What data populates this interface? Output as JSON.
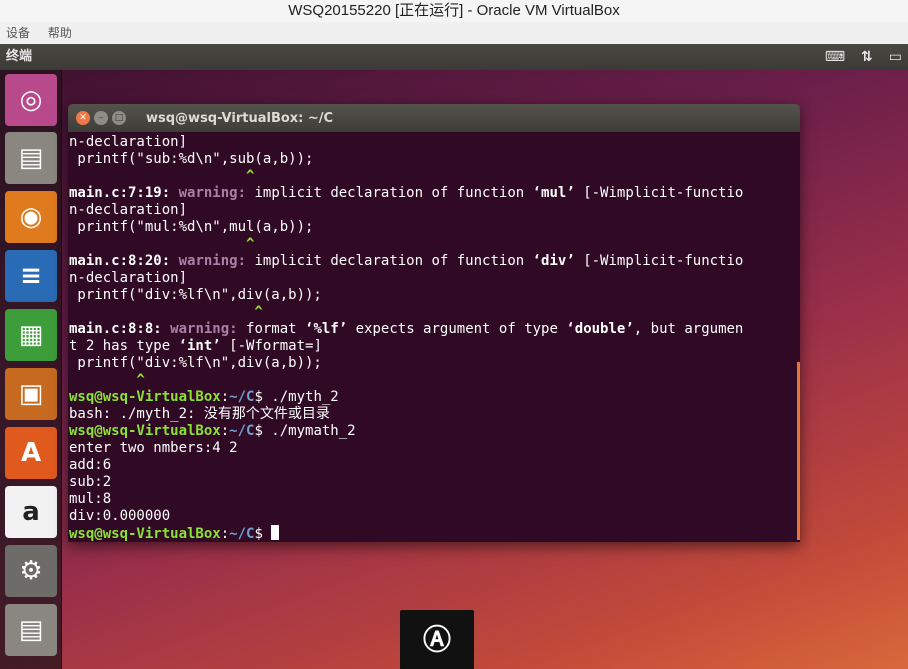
{
  "host": {
    "window_title": "WSQ20155220 [正在运行] - Oracle VM VirtualBox",
    "menu": [
      "设备",
      "帮助"
    ]
  },
  "guest": {
    "topbar_title": "终端",
    "topbar_icons": [
      "keyboard-icon",
      "network-updown-icon",
      "battery-icon"
    ],
    "launcher": [
      "ubuntu-dash",
      "files",
      "firefox",
      "libreoffice-writer",
      "libreoffice-calc",
      "libreoffice-impress",
      "ubuntu-software",
      "amazon",
      "system-settings",
      "files"
    ]
  },
  "terminal": {
    "title": "wsq@wsq-VirtualBox: ~/C",
    "prompt_user": "wsq@wsq-VirtualBox",
    "prompt_path": "~/C",
    "lines": {
      "l1": "n-declaration]",
      "l2": " printf(\"sub:%d\\n\",sub(a,b));",
      "l3": "                     ^",
      "l4_file": "main.c:7:19:",
      "l4_warn": "warning:",
      "l4_text_a": " implicit declaration of function ",
      "l4_quote": "‘mul’",
      "l4_text_b": " [-Wimplicit-functio",
      "l5": "n-declaration]",
      "l6": " printf(\"mul:%d\\n\",mul(a,b));",
      "l7": "                     ^",
      "l8_file": "main.c:8:20:",
      "l8_warn": "warning:",
      "l8_text_a": " implicit declaration of function ",
      "l8_quote": "‘div’",
      "l8_text_b": " [-Wimplicit-functio",
      "l9": "n-declaration]",
      "l10": " printf(\"div:%lf\\n\",div(a,b));",
      "l11": "                      ^",
      "l12_file": "main.c:8:8:",
      "l12_warn": "warning:",
      "l12_text_a": " format ",
      "l12_q1": "‘%lf’",
      "l12_text_b": " expects argument of type ",
      "l12_q2": "‘double’",
      "l12_text_c": ", but argumen",
      "l13_a": "t 2 has type ",
      "l13_q": "‘int’",
      "l13_b": " [-Wformat=]",
      "l14": " printf(\"div:%lf\\n\",div(a,b));",
      "l15": "        ^",
      "cmd1": "$ ./myth_2",
      "out1": "bash: ./myth_2: 没有那个文件或目录",
      "cmd2": "$ ./mymath_2",
      "out2": "enter two nmbers:4 2",
      "out3": "add:6",
      "out4": "sub:2",
      "out5": "mul:8",
      "out6": "div:0.000000",
      "cmd3": "$ "
    }
  }
}
